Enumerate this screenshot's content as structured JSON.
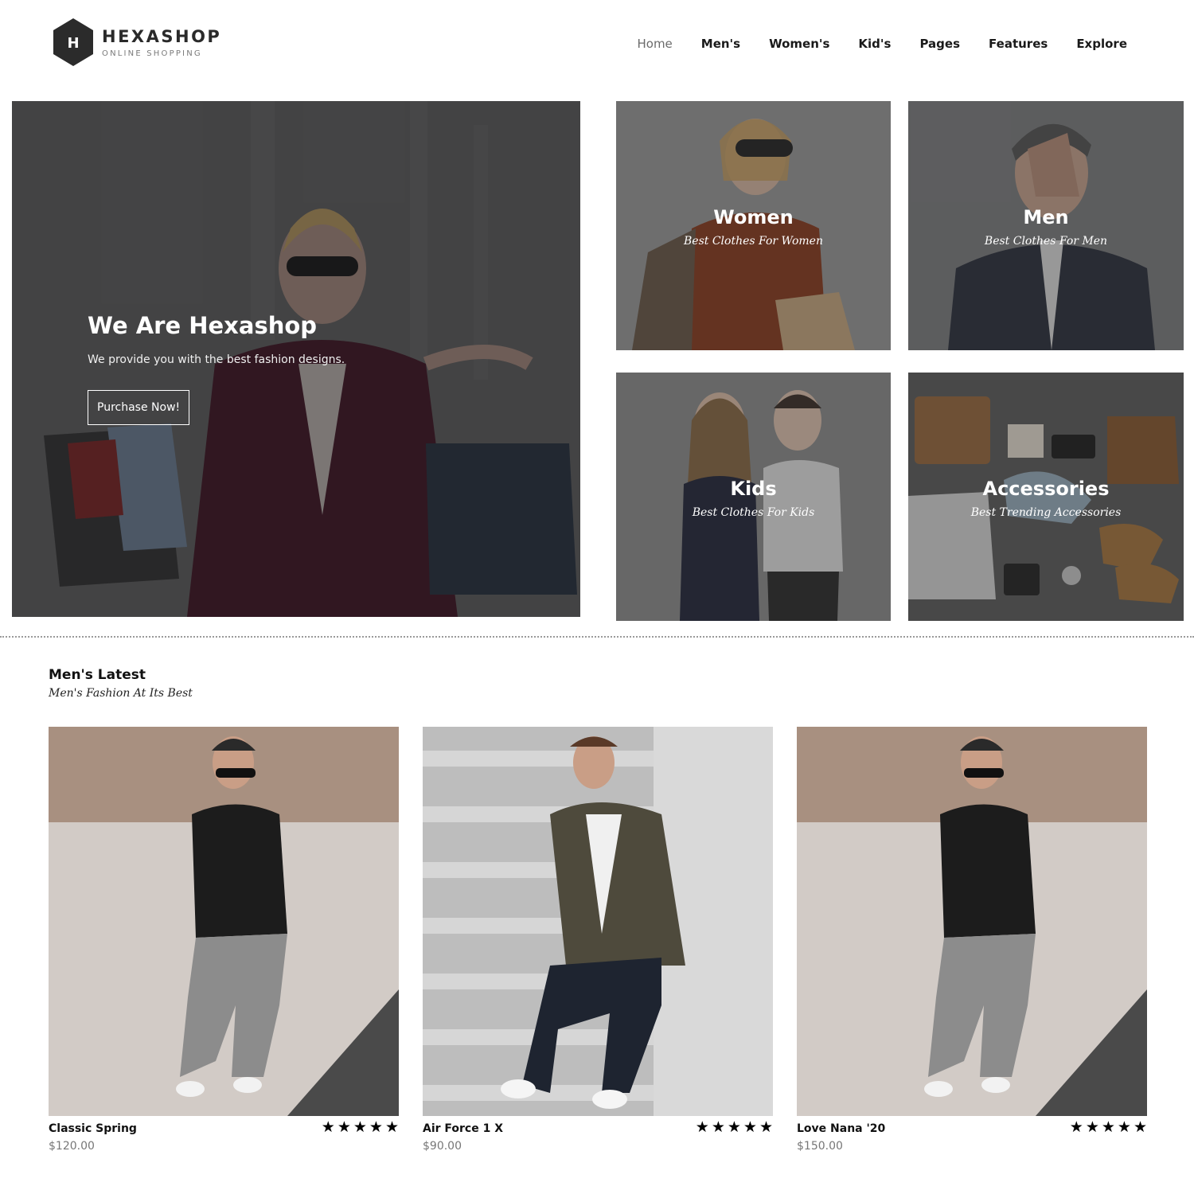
{
  "brand": {
    "logo_letter": "H",
    "name": "HEXASHOP",
    "tagline": "ONLINE SHOPPING"
  },
  "nav": [
    {
      "label": "Home",
      "active": true
    },
    {
      "label": "Men's"
    },
    {
      "label": "Women's"
    },
    {
      "label": "Kid's"
    },
    {
      "label": "Pages"
    },
    {
      "label": "Features"
    },
    {
      "label": "Explore"
    }
  ],
  "hero": {
    "title": "We Are Hexashop",
    "subtitle": "We provide you with the best fashion designs.",
    "button_label": "Purchase Now!"
  },
  "categories": [
    {
      "title": "Women",
      "subtitle": "Best Clothes For Women"
    },
    {
      "title": "Men",
      "subtitle": "Best Clothes For Men"
    },
    {
      "title": "Kids",
      "subtitle": "Best Clothes For Kids"
    },
    {
      "title": "Accessories",
      "subtitle": "Best Trending Accessories"
    }
  ],
  "section": {
    "title": "Men's Latest",
    "subtitle": "Men's Fashion At Its Best"
  },
  "products": [
    {
      "name": "Classic Spring",
      "price": "$120.00",
      "rating": 5
    },
    {
      "name": "Air Force 1 X",
      "price": "$90.00",
      "rating": 5
    },
    {
      "name": "Love Nana '20",
      "price": "$150.00",
      "rating": 5
    }
  ],
  "colors": {
    "logo_dark": "#2b2b2b",
    "text_dark": "#111111",
    "price_gray": "#777777"
  }
}
